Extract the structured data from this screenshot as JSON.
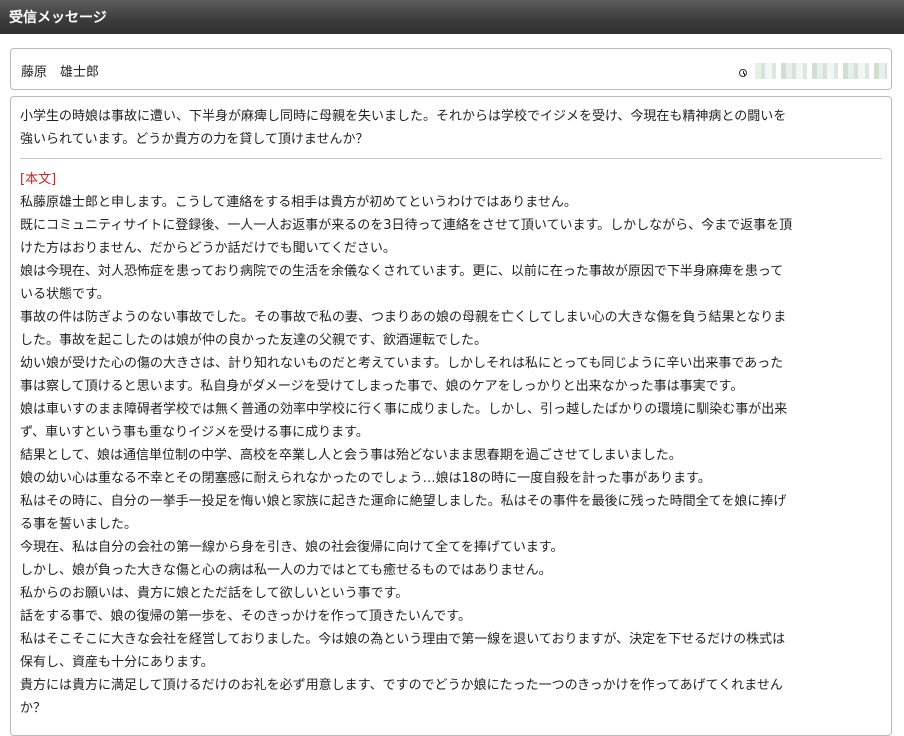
{
  "header": {
    "title": "受信メッセージ"
  },
  "sender": {
    "name": "藤原　雄士郎",
    "icon": "clock-icon"
  },
  "message": {
    "summary_lines": [
      "小学生の時娘は事故に遭い、下半身が麻痺し同時に母親を失いました。それからは学校でイジメを受け、今現在も精神病との闘いを",
      "強いられています。どうか貴方の力を貸して頂けませんか？"
    ],
    "body_label": "[本文]",
    "body_lines": [
      "私藤原雄士郎と申します。こうして連絡をする相手は貴方が初めてというわけではありません。",
      "既にコミュニティサイトに登録後、一人一人お返事が来るのを3日待って連絡をさせて頂いています。しかしながら、今まで返事を頂",
      "けた方はおりません、だからどうか話だけでも聞いてください。",
      "娘は今現在、対人恐怖症を患っており病院での生活を余儀なくされています。更に、以前に在った事故が原因で下半身麻痺を患って",
      "いる状態です。",
      "事故の件は防ぎようのない事故でした。その事故で私の妻、つまりあの娘の母親を亡くしてしまい心の大きな傷を負う結果となりま",
      "した。事故を起こしたのは娘が仲の良かった友達の父親です、飲酒運転でした。",
      "幼い娘が受けた心の傷の大きさは、計り知れないものだと考えています。しかしそれは私にとっても同じように辛い出来事であった",
      "事は察して頂けると思います。私自身がダメージを受けてしまった事で、娘のケアをしっかりと出来なかった事は事実です。",
      "娘は車いすのまま障碍者学校では無く普通の効率中学校に行く事に成りました。しかし、引っ越したばかりの環境に馴染む事が出来",
      "ず、車いすという事も重なりイジメを受ける事に成ります。",
      "結果として、娘は通信単位制の中学、高校を卒業し人と会う事は殆どないまま思春期を過ごさせてしまいました。",
      "娘の幼い心は重なる不幸とその閉塞感に耐えられなかったのでしょう…娘は18の時に一度自殺を計った事があります。",
      "私はその時に、自分の一挙手一投足を悔い娘と家族に起きた運命に絶望しました。私はその事件を最後に残った時間全てを娘に捧げ",
      "る事を誓いました。",
      "今現在、私は自分の会社の第一線から身を引き、娘の社会復帰に向けて全てを捧げています。",
      "しかし、娘が負った大きな傷と心の病は私一人の力ではとても癒せるものではありません。",
      "私からのお願いは、貴方に娘とただ話をして欲しいという事です。",
      "話をする事で、娘の復帰の第一歩を、そのきっかけを作って頂きたいんです。",
      "私はそこそこに大きな会社を経営しておりました。今は娘の為という理由で第一線を退いておりますが、決定を下せるだけの株式は",
      "保有し、資産も十分にあります。",
      "貴方には貴方に満足して頂けるだけのお礼を必ず用意します、ですのでどうか娘にたった一つのきっかけを作ってあげてくれません",
      "か？"
    ]
  }
}
